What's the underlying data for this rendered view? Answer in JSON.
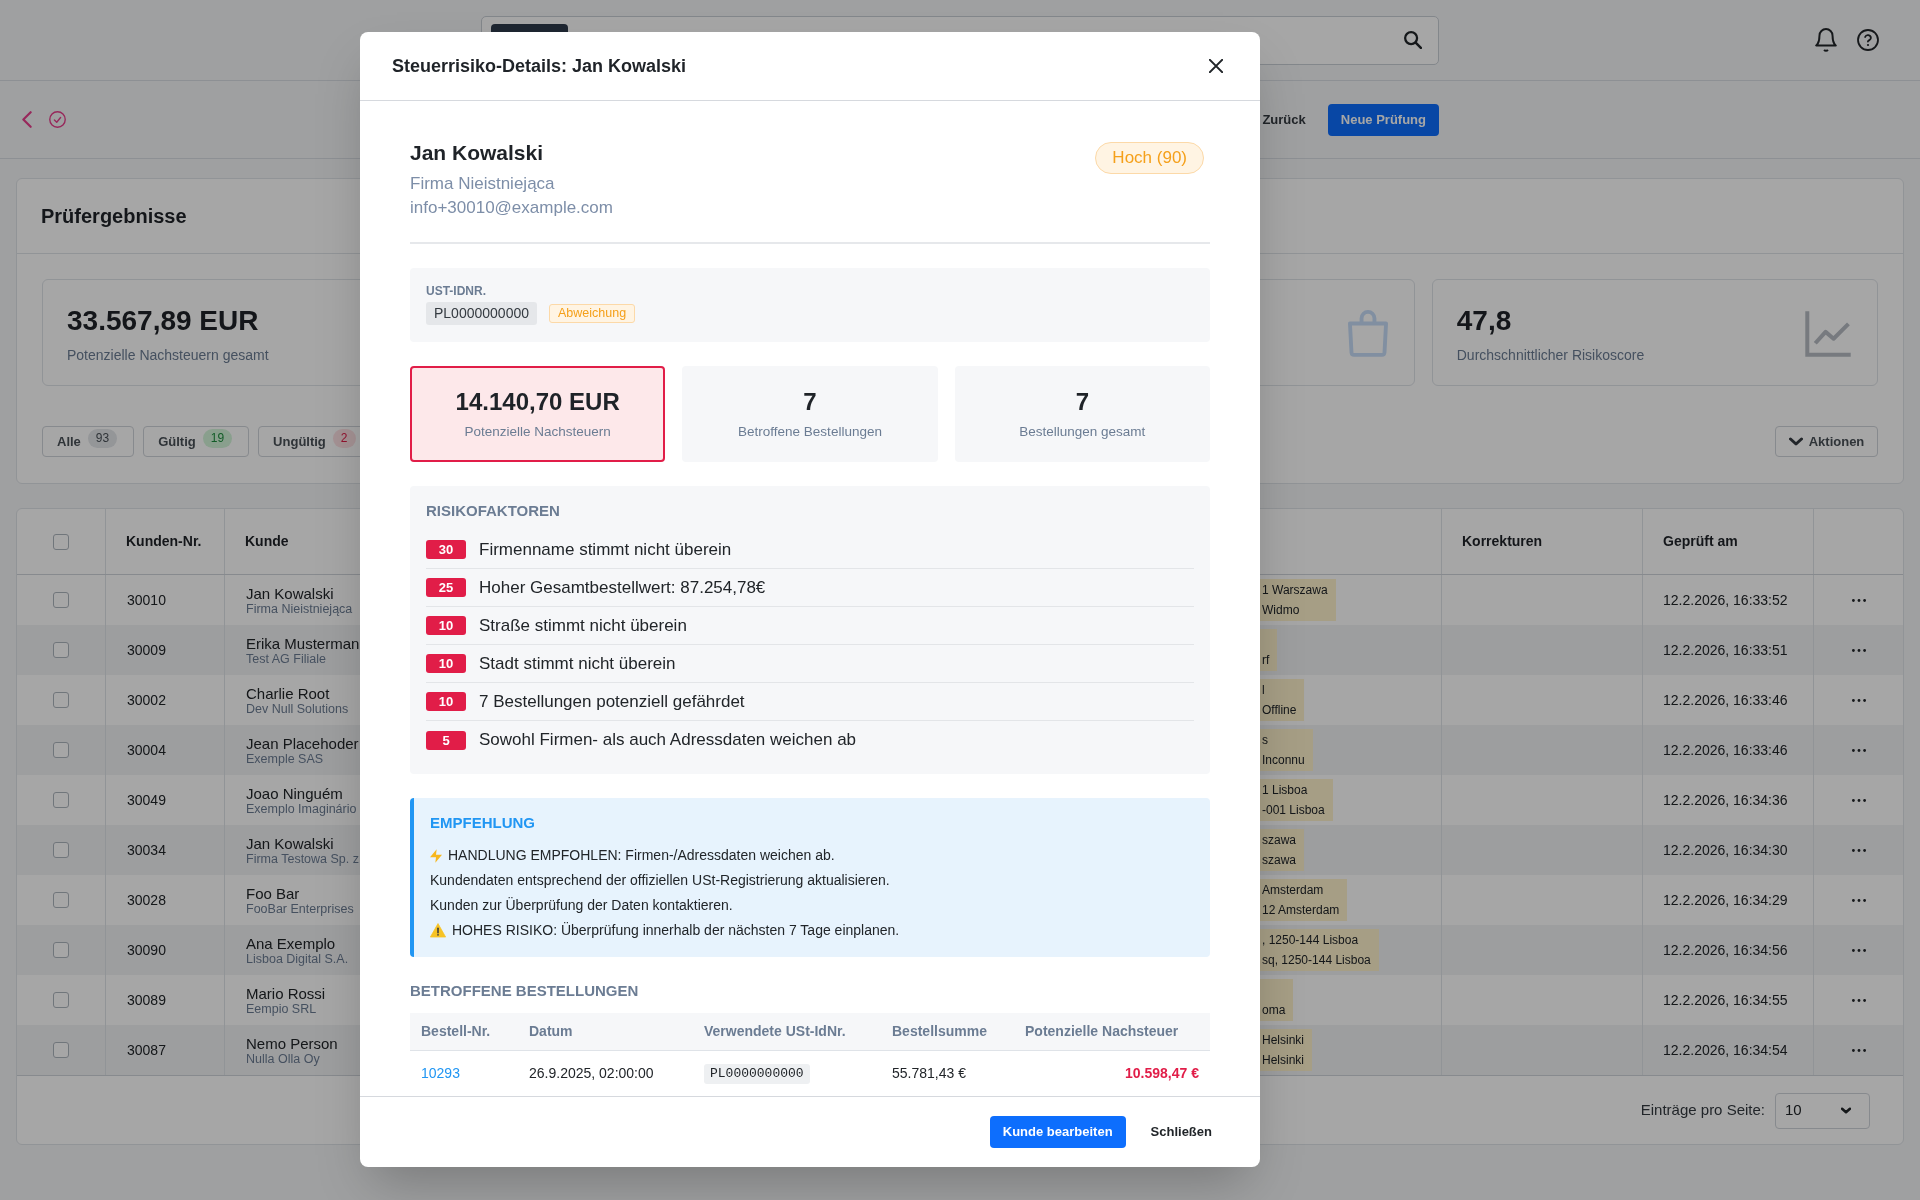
{
  "toolbar": {
    "buttons": [
      {
        "kind": "link",
        "label": "Zurück"
      },
      {
        "kind": "primary",
        "label": "Neue Prüfung"
      }
    ]
  },
  "results": {
    "title": "Prüfergebnisse",
    "stats": [
      {
        "value": "33.567,89 EUR",
        "label": "Potenzielle Nachsteuern gesamt"
      },
      {
        "value": "47,8",
        "label": "Durchschnittlicher Risikoscore"
      }
    ],
    "filters": [
      {
        "label": "Alle",
        "count": "93",
        "kind": "neutral"
      },
      {
        "label": "Gültig",
        "count": "19",
        "kind": "valid"
      },
      {
        "label": "Ungültig",
        "count": "2",
        "kind": "invalid"
      }
    ],
    "actions_button": "Aktionen"
  },
  "table": {
    "select_all_checked": false,
    "columns": [
      "Kunden-Nr.",
      "Kunde",
      "Korrekturen",
      "Geprüft am"
    ],
    "rows": [
      {
        "checked": false,
        "number": "30010",
        "name": "Jan Kowalski",
        "company": "Firma Nieistniejąca",
        "address": {
          "line_1": "1 Warszawa",
          "line_2": "Widmo"
        },
        "checked_at": "12.2.2026, 16:33:52"
      },
      {
        "checked": false,
        "number": "30009",
        "name": "Erika Musterman",
        "company": "Test AG Filiale",
        "address": {
          "line_2": "rf"
        },
        "checked_at": "12.2.2026, 16:33:51"
      },
      {
        "checked": false,
        "number": "30002",
        "name": "Charlie Root",
        "company": "Dev Null Solutions",
        "address": {
          "line_1": "l",
          "line_2": "Offline"
        },
        "checked_at": "12.2.2026, 16:33:46"
      },
      {
        "checked": false,
        "number": "30004",
        "name": "Jean Placehoder",
        "company": "Exemple SAS",
        "address": {
          "line_1": "s",
          "line_2": "Inconnu"
        },
        "checked_at": "12.2.2026, 16:33:46"
      },
      {
        "checked": false,
        "number": "30049",
        "name": "Joao Ninguém",
        "company": "Exemplo Imaginário",
        "address": {
          "line_1": "1 Lisboa",
          "line_2": "-001 Lisboa"
        },
        "checked_at": "12.2.2026, 16:34:36"
      },
      {
        "checked": false,
        "number": "30034",
        "name": "Jan Kowalski",
        "company": "Firma Testowa Sp. z",
        "address": {
          "line_1": "szawa",
          "line_2": "szawa"
        },
        "checked_at": "12.2.2026, 16:34:30"
      },
      {
        "checked": false,
        "number": "30028",
        "name": "Foo Bar",
        "company": "FooBar Enterprises",
        "address": {
          "line_1": "Amsterdam",
          "line_2": "12 Amsterdam"
        },
        "checked_at": "12.2.2026, 16:34:29"
      },
      {
        "checked": false,
        "number": "30090",
        "name": "Ana Exemplo",
        "company": "Lisboa Digital S.A.",
        "address": {
          "line_1": ", 1250-144 Lisboa",
          "line_2": "sq, 1250-144 Lisboa"
        },
        "checked_at": "12.2.2026, 16:34:56"
      },
      {
        "checked": false,
        "number": "30089",
        "name": "Mario Rossi",
        "company": "Eempio SRL",
        "address": {
          "line_2": "oma"
        },
        "checked_at": "12.2.2026, 16:34:55"
      },
      {
        "checked": false,
        "number": "30087",
        "name": "Nemo Person",
        "company": "Nulla Olla Oy",
        "address": {
          "line_1": "Helsinki",
          "line_2": "Helsinki"
        },
        "checked_at": "12.2.2026, 16:34:54"
      }
    ],
    "footer": {
      "label": "Einträge pro Seite:",
      "page_size": "10"
    }
  },
  "modal": {
    "title": "Steuerrisiko-Details: Jan Kowalski",
    "customer": {
      "name": "Jan Kowalski",
      "company": "Firma Nieistniejąca",
      "email": "info+30010@example.com",
      "risk": "Hoch (90)"
    },
    "vat": {
      "label": "UST-IDNR.",
      "number": "PL0000000000",
      "status": "Abweichung"
    },
    "metrics": [
      {
        "value": "14.140,70 EUR",
        "label": "Potenzielle Nachsteuern",
        "highlighted": true
      },
      {
        "value": "7",
        "label": "Betroffene Bestellungen",
        "highlighted": false
      },
      {
        "value": "7",
        "label": "Bestellungen gesamt",
        "highlighted": false
      }
    ],
    "risk_factors": {
      "title": "RISIKOFAKTOREN",
      "items": [
        {
          "points": "30",
          "text": "Firmenname stimmt nicht überein"
        },
        {
          "points": "25",
          "text": "Hoher Gesamtbestellwert: 87.254,78€"
        },
        {
          "points": "10",
          "text": "Straße stimmt nicht überein"
        },
        {
          "points": "10",
          "text": "Stadt stimmt nicht überein"
        },
        {
          "points": "10",
          "text": "7 Bestellungen potenziell gefährdet"
        },
        {
          "points": "5",
          "text": "Sowohl Firmen- als auch Adressdaten weichen ab"
        }
      ]
    },
    "recommendation": {
      "title": "EMPFEHLUNG",
      "lines": [
        {
          "kind": "action",
          "text": "HANDLUNG EMPFOHLEN: Firmen-/Adressdaten weichen ab."
        },
        {
          "kind": "text",
          "text": "Kundendaten entsprechend der offiziellen USt-Registrierung aktualisieren."
        },
        {
          "kind": "text",
          "text": "Kunden zur Überprüfung der Daten kontaktieren."
        },
        {
          "kind": "warning",
          "text": "HOHES RISIKO: Überprüfung innerhalb der nächsten 7 Tage einplanen."
        }
      ]
    },
    "orders": {
      "title": "BETROFFENE BESTELLUNGEN",
      "columns": [
        "Bestell-Nr.",
        "Datum",
        "Verwendete USt-IdNr.",
        "Bestellsumme",
        "Potenzielle Nachsteuer"
      ],
      "rows": [
        {
          "number": "10293",
          "date": "26.9.2025, 02:00:00",
          "vat_id": "PL0000000000",
          "total": "55.781,43 €",
          "tax": "10.598,47 €"
        }
      ]
    },
    "buttons": [
      {
        "kind": "primary",
        "label": "Kunde bearbeiten"
      },
      {
        "kind": "plain",
        "label": "Schließen"
      }
    ]
  }
}
